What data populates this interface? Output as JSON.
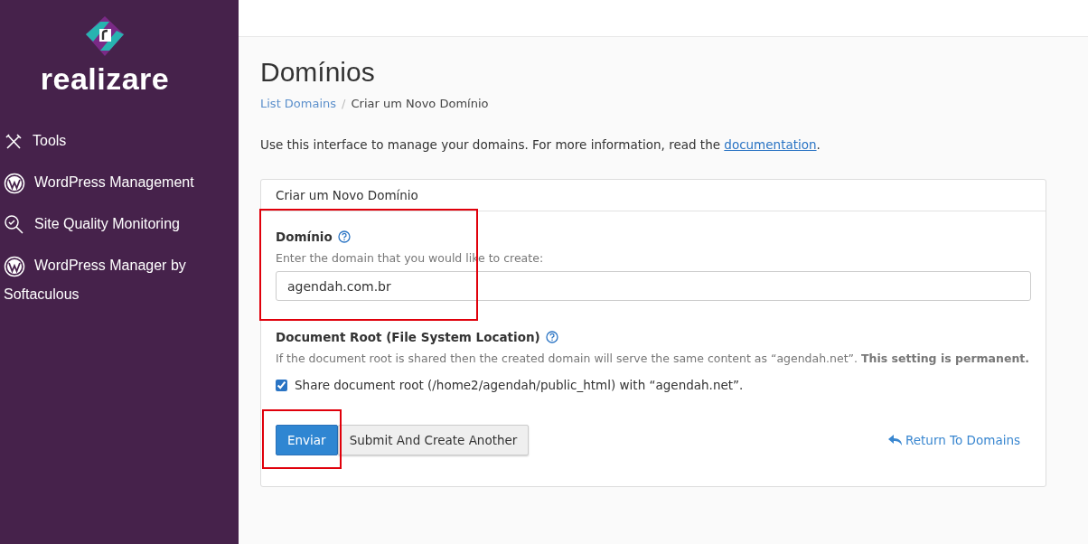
{
  "sidebar": {
    "logo": "realizare",
    "items": [
      {
        "kind": "tools",
        "label": "Tools"
      },
      {
        "kind": "wordpress",
        "label": "WordPress Management"
      },
      {
        "kind": "quality",
        "label": "Site Quality Monitoring"
      },
      {
        "kind": "wordpress",
        "label": "WordPress Manager by Softaculous"
      }
    ]
  },
  "page": {
    "title": "Domínios",
    "separator": "/",
    "breadcrumb": [
      {
        "label": "List Domains",
        "link": true
      },
      {
        "label": "Criar um Novo Domínio",
        "link": false
      }
    ],
    "intro": "Use this interface to manage your domains. For more information, read the ",
    "intro_link": "documentation",
    "intro_end": "."
  },
  "card": {
    "title": "Criar um Novo Domínio",
    "domain": {
      "label": "Domínio",
      "hint": "Enter the domain that you would like to create:",
      "value": "agendah.com.br"
    },
    "docroot": {
      "label": "Document Root (File System Location)",
      "hint": "If the document root is shared then the created domain will serve the same content as “agendah.net”. **This setting is permanent.**",
      "checkbox": {
        "label": "Share document root (/home2/agendah/public_html) with “agendah.net”.",
        "checked": true
      }
    },
    "buttons": [
      {
        "kind": "primary",
        "label": "Enviar"
      },
      {
        "kind": "default",
        "label": "Submit And Create Another"
      }
    ],
    "return_link": "Return To Domains"
  }
}
